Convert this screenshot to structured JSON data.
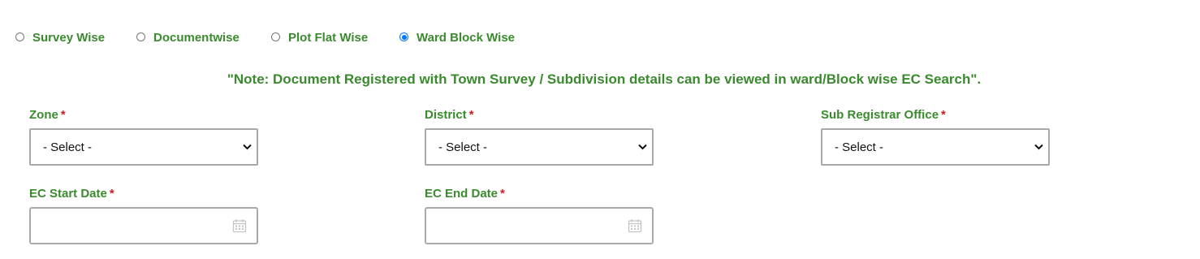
{
  "search_type": {
    "options": [
      {
        "label": "Survey Wise",
        "selected": false
      },
      {
        "label": "Documentwise",
        "selected": false
      },
      {
        "label": "Plot Flat Wise",
        "selected": false
      },
      {
        "label": "Ward Block Wise",
        "selected": true
      }
    ]
  },
  "note": "\"Note: Document Registered with Town Survey / Subdivision details can be viewed in ward/Block wise EC Search\".",
  "fields": {
    "zone": {
      "label": "Zone",
      "required_mark": "*",
      "value": "- Select -"
    },
    "district": {
      "label": "District",
      "required_mark": "*",
      "value": "- Select -"
    },
    "sub_registrar_office": {
      "label": "Sub Registrar Office",
      "required_mark": "*",
      "value": "- Select -"
    },
    "ec_start_date": {
      "label": "EC Start Date",
      "required_mark": "*",
      "value": ""
    },
    "ec_end_date": {
      "label": "EC End Date",
      "required_mark": "*",
      "value": ""
    }
  },
  "colors": {
    "label_green": "#3a8a2e",
    "required_red": "#cc1f1f",
    "radio_selected": "#0075ff",
    "input_border": "#a9a9a9"
  },
  "icons": {
    "select_arrow": "chevron-down-icon",
    "date_picker": "calendar-icon"
  }
}
